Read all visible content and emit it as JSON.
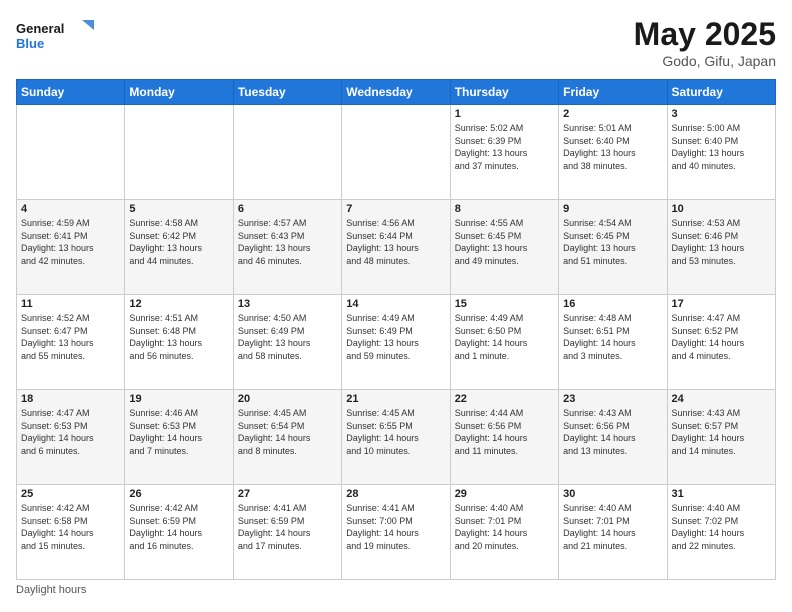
{
  "header": {
    "logo_general": "General",
    "logo_blue": "Blue",
    "month_year": "May 2025",
    "location": "Godo, Gifu, Japan"
  },
  "days_of_week": [
    "Sunday",
    "Monday",
    "Tuesday",
    "Wednesday",
    "Thursday",
    "Friday",
    "Saturday"
  ],
  "footer": {
    "daylight_hours": "Daylight hours"
  },
  "weeks": [
    [
      {
        "day": "",
        "info": ""
      },
      {
        "day": "",
        "info": ""
      },
      {
        "day": "",
        "info": ""
      },
      {
        "day": "",
        "info": ""
      },
      {
        "day": "1",
        "info": "Sunrise: 5:02 AM\nSunset: 6:39 PM\nDaylight: 13 hours\nand 37 minutes."
      },
      {
        "day": "2",
        "info": "Sunrise: 5:01 AM\nSunset: 6:40 PM\nDaylight: 13 hours\nand 38 minutes."
      },
      {
        "day": "3",
        "info": "Sunrise: 5:00 AM\nSunset: 6:40 PM\nDaylight: 13 hours\nand 40 minutes."
      }
    ],
    [
      {
        "day": "4",
        "info": "Sunrise: 4:59 AM\nSunset: 6:41 PM\nDaylight: 13 hours\nand 42 minutes."
      },
      {
        "day": "5",
        "info": "Sunrise: 4:58 AM\nSunset: 6:42 PM\nDaylight: 13 hours\nand 44 minutes."
      },
      {
        "day": "6",
        "info": "Sunrise: 4:57 AM\nSunset: 6:43 PM\nDaylight: 13 hours\nand 46 minutes."
      },
      {
        "day": "7",
        "info": "Sunrise: 4:56 AM\nSunset: 6:44 PM\nDaylight: 13 hours\nand 48 minutes."
      },
      {
        "day": "8",
        "info": "Sunrise: 4:55 AM\nSunset: 6:45 PM\nDaylight: 13 hours\nand 49 minutes."
      },
      {
        "day": "9",
        "info": "Sunrise: 4:54 AM\nSunset: 6:45 PM\nDaylight: 13 hours\nand 51 minutes."
      },
      {
        "day": "10",
        "info": "Sunrise: 4:53 AM\nSunset: 6:46 PM\nDaylight: 13 hours\nand 53 minutes."
      }
    ],
    [
      {
        "day": "11",
        "info": "Sunrise: 4:52 AM\nSunset: 6:47 PM\nDaylight: 13 hours\nand 55 minutes."
      },
      {
        "day": "12",
        "info": "Sunrise: 4:51 AM\nSunset: 6:48 PM\nDaylight: 13 hours\nand 56 minutes."
      },
      {
        "day": "13",
        "info": "Sunrise: 4:50 AM\nSunset: 6:49 PM\nDaylight: 13 hours\nand 58 minutes."
      },
      {
        "day": "14",
        "info": "Sunrise: 4:49 AM\nSunset: 6:49 PM\nDaylight: 13 hours\nand 59 minutes."
      },
      {
        "day": "15",
        "info": "Sunrise: 4:49 AM\nSunset: 6:50 PM\nDaylight: 14 hours\nand 1 minute."
      },
      {
        "day": "16",
        "info": "Sunrise: 4:48 AM\nSunset: 6:51 PM\nDaylight: 14 hours\nand 3 minutes."
      },
      {
        "day": "17",
        "info": "Sunrise: 4:47 AM\nSunset: 6:52 PM\nDaylight: 14 hours\nand 4 minutes."
      }
    ],
    [
      {
        "day": "18",
        "info": "Sunrise: 4:47 AM\nSunset: 6:53 PM\nDaylight: 14 hours\nand 6 minutes."
      },
      {
        "day": "19",
        "info": "Sunrise: 4:46 AM\nSunset: 6:53 PM\nDaylight: 14 hours\nand 7 minutes."
      },
      {
        "day": "20",
        "info": "Sunrise: 4:45 AM\nSunset: 6:54 PM\nDaylight: 14 hours\nand 8 minutes."
      },
      {
        "day": "21",
        "info": "Sunrise: 4:45 AM\nSunset: 6:55 PM\nDaylight: 14 hours\nand 10 minutes."
      },
      {
        "day": "22",
        "info": "Sunrise: 4:44 AM\nSunset: 6:56 PM\nDaylight: 14 hours\nand 11 minutes."
      },
      {
        "day": "23",
        "info": "Sunrise: 4:43 AM\nSunset: 6:56 PM\nDaylight: 14 hours\nand 13 minutes."
      },
      {
        "day": "24",
        "info": "Sunrise: 4:43 AM\nSunset: 6:57 PM\nDaylight: 14 hours\nand 14 minutes."
      }
    ],
    [
      {
        "day": "25",
        "info": "Sunrise: 4:42 AM\nSunset: 6:58 PM\nDaylight: 14 hours\nand 15 minutes."
      },
      {
        "day": "26",
        "info": "Sunrise: 4:42 AM\nSunset: 6:59 PM\nDaylight: 14 hours\nand 16 minutes."
      },
      {
        "day": "27",
        "info": "Sunrise: 4:41 AM\nSunset: 6:59 PM\nDaylight: 14 hours\nand 17 minutes."
      },
      {
        "day": "28",
        "info": "Sunrise: 4:41 AM\nSunset: 7:00 PM\nDaylight: 14 hours\nand 19 minutes."
      },
      {
        "day": "29",
        "info": "Sunrise: 4:40 AM\nSunset: 7:01 PM\nDaylight: 14 hours\nand 20 minutes."
      },
      {
        "day": "30",
        "info": "Sunrise: 4:40 AM\nSunset: 7:01 PM\nDaylight: 14 hours\nand 21 minutes."
      },
      {
        "day": "31",
        "info": "Sunrise: 4:40 AM\nSunset: 7:02 PM\nDaylight: 14 hours\nand 22 minutes."
      }
    ]
  ]
}
